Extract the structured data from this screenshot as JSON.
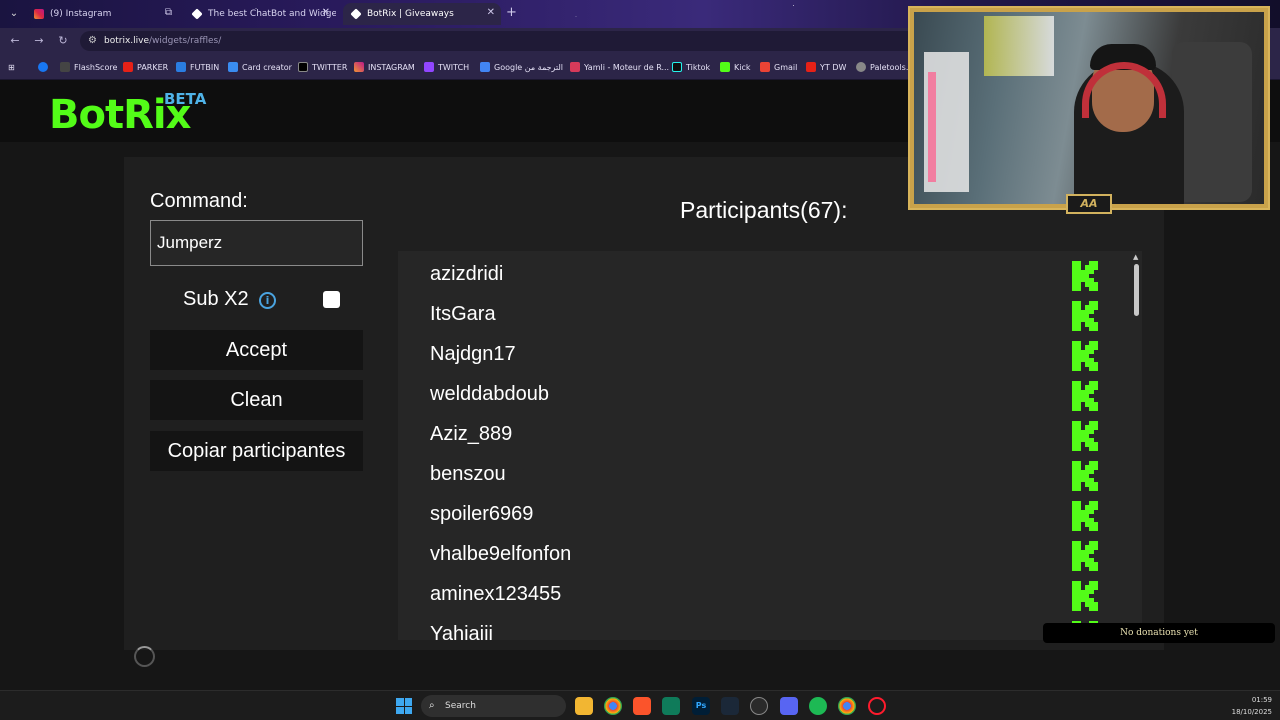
{
  "browser": {
    "tabs": [
      {
        "label": "(9) Instagram",
        "active": false
      },
      {
        "label": "The best ChatBot and Widgets",
        "active": false
      },
      {
        "label": "BotRix | Giveaways",
        "active": true
      }
    ],
    "url_host": "botrix.live",
    "url_path": "/widgets/raffles/",
    "bookmarks": [
      "FlashScore",
      "PARKER",
      "FUTBIN",
      "Card creator",
      "TWITTER",
      "INSTAGRAM",
      "TWITCH",
      "Google الترجمة من",
      "Yamli - Moteur de R...",
      "Tiktok",
      "Kick",
      "Gmail",
      "YT DW",
      "Paletools.v..."
    ]
  },
  "header": {
    "logo": "BotRix",
    "badge": "BETA"
  },
  "form": {
    "command_label": "Command:",
    "command_value": "Jumperz",
    "sub_label": "Sub X2",
    "sub_checked": false,
    "accept_label": "Accept",
    "clean_label": "Clean",
    "copy_label": "Copiar participantes"
  },
  "participants": {
    "title": "Participants(67):",
    "items": [
      "azizdridi",
      "ItsGara",
      "Najdgn17",
      "welddabdoub",
      "Aziz_889",
      "benszou",
      "spoiler6969",
      "vhalbe9elfonfon",
      "aminex123455",
      "Yahiaiii"
    ]
  },
  "overlay": {
    "donations_text": "No donations yet"
  },
  "taskbar": {
    "search_label": "Search",
    "time": "01:59",
    "date": "18/10/2025"
  },
  "colors": {
    "brand_green": "#53fc18",
    "beta_blue": "#4fb3e8"
  }
}
